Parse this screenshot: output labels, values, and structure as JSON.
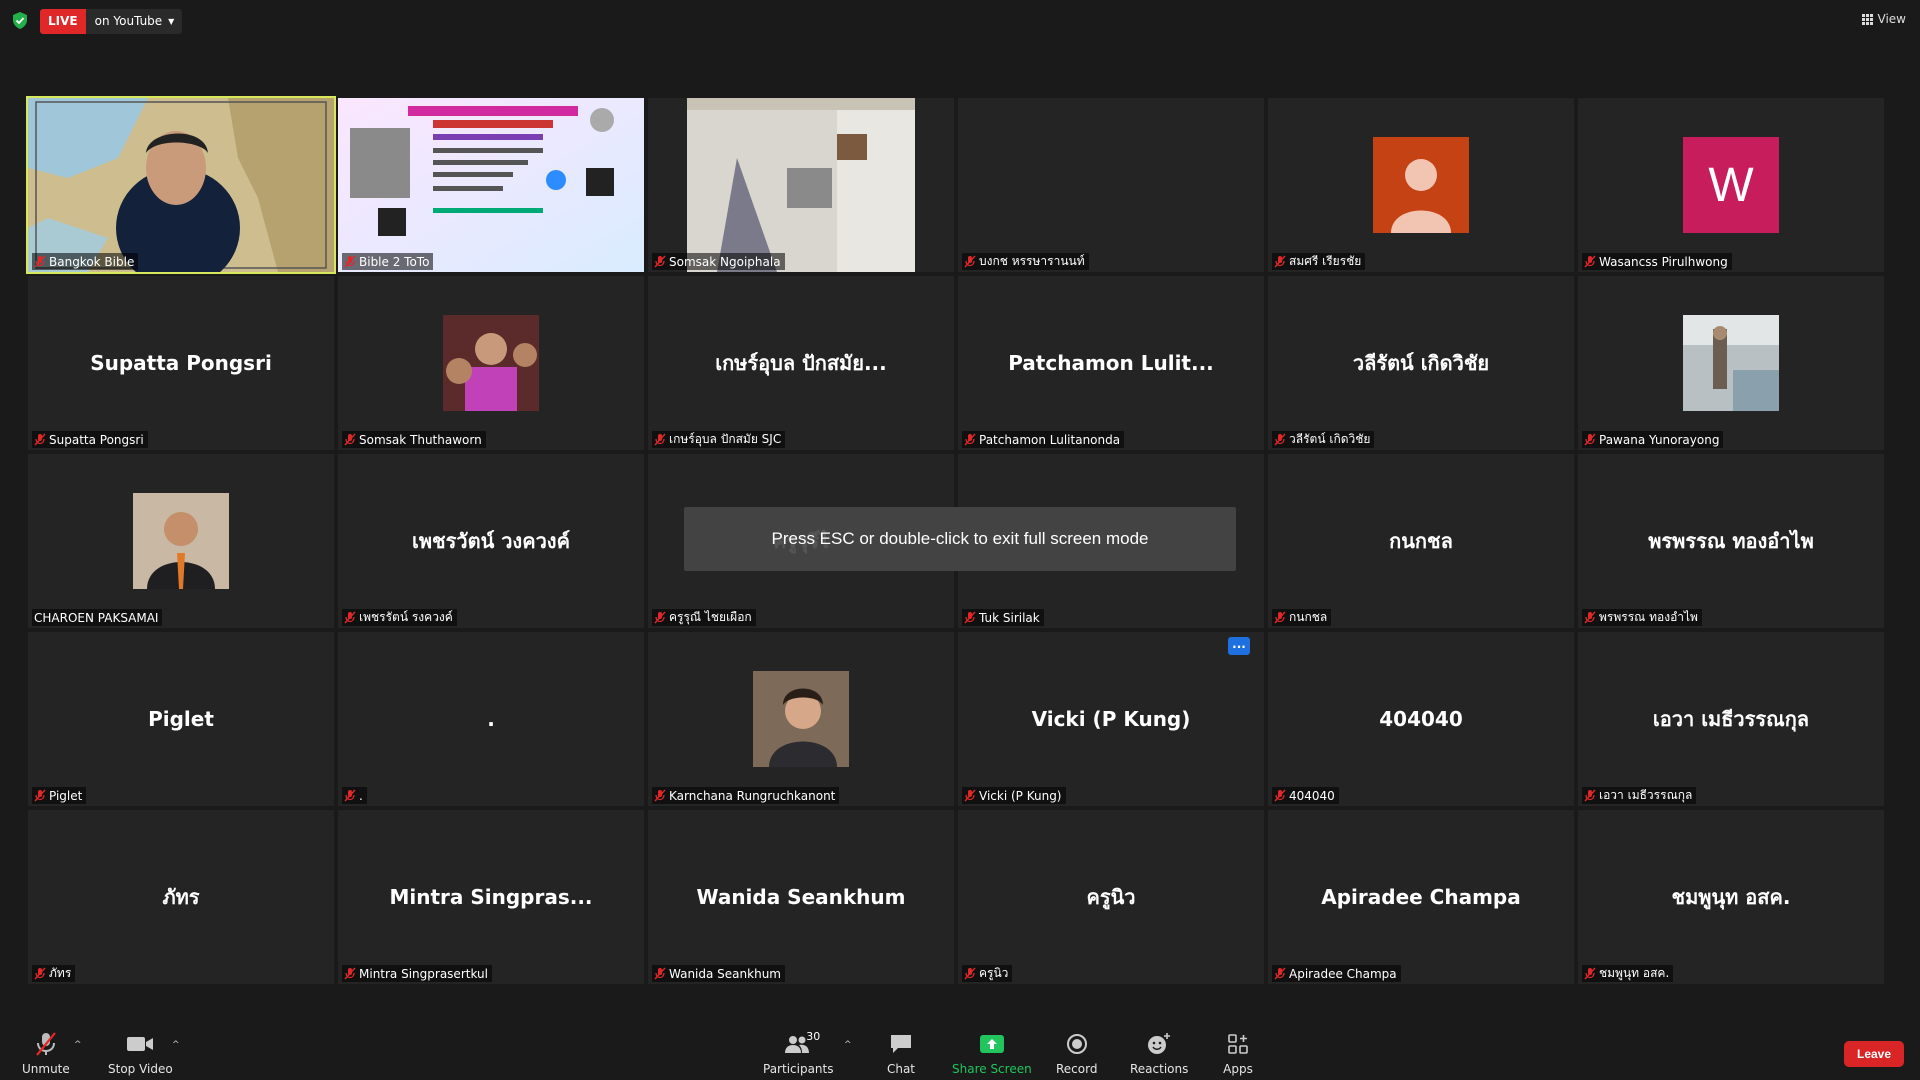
{
  "topbar": {
    "live_label": "LIVE",
    "live_platform": "on YouTube",
    "view_label": "View"
  },
  "toast": "Press ESC or double-click to exit full screen mode",
  "tiles": [
    {
      "label": "Bangkok Bible",
      "kind": "video-map"
    },
    {
      "label": "Bible 2 ToTo",
      "kind": "video-poster"
    },
    {
      "label": "Somsak Ngoiphala",
      "kind": "video-room"
    },
    {
      "label": "บงกช หรรษารานนท์",
      "kind": "empty"
    },
    {
      "label": "สมศรี เรียรชัย",
      "kind": "avatar-person"
    },
    {
      "label": "Wasancss Pirulhwong",
      "kind": "avatar-initial",
      "initial": "W"
    },
    {
      "label": "Supatta Pongsri",
      "kind": "name",
      "big": "Supatta Pongsri"
    },
    {
      "label": "Somsak Thuthaworn",
      "kind": "photo-kids"
    },
    {
      "label": "เกษร์อุบล ปักสมัย SJC",
      "kind": "name",
      "big": "เกษร์อุบล ปักสมัย..."
    },
    {
      "label": "Patchamon Lulitanonda",
      "kind": "name",
      "big": "Patchamon  Lulit..."
    },
    {
      "label": "วลีรัตน์ เกิดวิชัย",
      "kind": "name",
      "big": "วลีรัตน์  เกิดวิชัย"
    },
    {
      "label": "Pawana Yunorayong",
      "kind": "photo-class"
    },
    {
      "label": "CHAROEN PAKSAMAI",
      "kind": "photo-man",
      "unmuted": true
    },
    {
      "label": "เพชรรัตน์ รงควงค์",
      "kind": "name",
      "big": "เพชรวัตน์ วงควงค์"
    },
    {
      "label": "ครูรุณี ไชยเผือก",
      "kind": "name",
      "big": "ครูวุรีไ"
    },
    {
      "label": "Tuk Sirilak",
      "kind": "name",
      "big": ""
    },
    {
      "label": "กนกชล",
      "kind": "name",
      "big": "กนกชล"
    },
    {
      "label": "พรพรรณ ทองอำไพ",
      "kind": "name",
      "big": "พรพรรณ ทองอำไพ"
    },
    {
      "label": "Piglet",
      "kind": "name",
      "big": "Piglet"
    },
    {
      "label": ".",
      "kind": "name",
      "big": "."
    },
    {
      "label": "Karnchana Rungruchkanont",
      "kind": "photo-woman"
    },
    {
      "label": "Vicki (P Kung)",
      "kind": "name",
      "big": "Vicki (P Kung)",
      "more": "..."
    },
    {
      "label": "404040",
      "kind": "name",
      "big": "404040"
    },
    {
      "label": "เอวา เมธีวรรณกุล",
      "kind": "name",
      "big": "เอวา เมธีวรรณกุล"
    },
    {
      "label": "ภัทร",
      "kind": "name",
      "big": "ภัทร"
    },
    {
      "label": "Mintra Singprasertkul",
      "kind": "name",
      "big": "Mintra  Singpras..."
    },
    {
      "label": "Wanida Seankhum",
      "kind": "name",
      "big": "Wanida Seankhum"
    },
    {
      "label": "ครูนิว",
      "kind": "name",
      "big": "ครูนิว"
    },
    {
      "label": "Apiradee Champa",
      "kind": "name",
      "big": "Apiradee Champa"
    },
    {
      "label": "ชมพูนุท อสค.",
      "kind": "name",
      "big": "ชมพูนุท อสค."
    }
  ],
  "toolbar": {
    "unmute": "Unmute",
    "stop_video": "Stop Video",
    "participants": "Participants",
    "participants_count": "30",
    "chat": "Chat",
    "share_screen": "Share Screen",
    "record": "Record",
    "reactions": "Reactions",
    "apps": "Apps",
    "leave": "Leave"
  },
  "colors": {
    "live_red": "#e02828",
    "active_speaker": "#d7e85a",
    "share_green": "#21c45d",
    "leave_red": "#d92525",
    "muted_mic": "#e02828"
  }
}
